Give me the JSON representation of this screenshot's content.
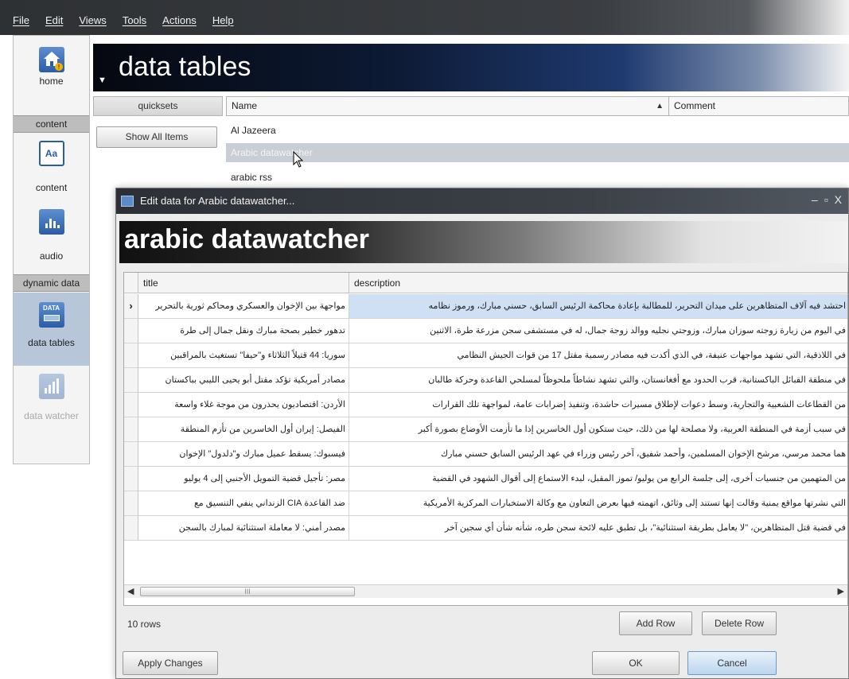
{
  "menu": [
    "File",
    "Edit",
    "Views",
    "Tools",
    "Actions",
    "Help"
  ],
  "sidebar": {
    "home": "home",
    "content_header": "content",
    "content": "content",
    "audio": "audio",
    "dynamic_header": "dynamic data",
    "data_tables": "data tables",
    "data_tables_icon_text": "DATA",
    "data_watcher": "data watcher"
  },
  "banner": {
    "title": "data tables"
  },
  "backpanel": {
    "quicksets": "quicksets",
    "show_all": "Show All Items",
    "name_header": "Name",
    "comment_header": "Comment",
    "sort_indicator": "▲",
    "rows": [
      "Al Jazeera",
      "Arabic datawatcher",
      "arabic rss"
    ]
  },
  "dialog": {
    "title": "Edit data for Arabic datawatcher...",
    "banner": "arabic datawatcher",
    "col_title": "title",
    "col_description": "description",
    "current_row_marker": "›",
    "rows": [
      {
        "title": "مواجهة بين الإخوان والعسكري ومحاكم ثورية بالتحرير",
        "description": "احتشد فيه آلاف المتظاهرين على ميدان التحرير، للمطالبة بإعادة محاكمة الرئيس السابق، حسني مبارك، ورموز نظامه"
      },
      {
        "title": "تدهور خطير بصحة مبارك ونقل جمال إلى طرة",
        "description": "في اليوم من زيارة زوجته سوزان مبارك، وزوجتي نجليه ووالد زوجة جمال، له في مستشفى سجن مزرعة طرة، الاثنين"
      },
      {
        "title": "سوريا: 44 قتيلاً الثلاثاء و\"حيفا\" تستغيث بالمراقبين",
        "description": "في اللاذقية، التي تشهد مواجهات عنيفة، في الذي أكدت فيه مصادر رسمية مقتل 17 من قوات الجيش النظامي"
      },
      {
        "title": "مصادر أمريكية تؤكد مقتل أبو يحيى الليبي بباكستان",
        "description": "في منطقة القبائل الباكستانية، قرب الحدود مع أفغانستان، والتي تشهد نشاطاً ملحوظاً لمسلحي القاعدة وحركة طالبان"
      },
      {
        "title": "الأردن: اقتصاديون يحذرون من موجة غلاء واسعة",
        "description": "من القطاعات الشعبية والتجارية، وسط دعوات لإطلاق مسيرات حاشدة، وتنفيذ إضرابات عامة، لمواجهة تلك القرارات"
      },
      {
        "title": "الفيصل: إيران أول الخاسرين من تأزم المنطقة",
        "description": "في سبب أزمة في المنطقة العربية، ولا مصلحة لها من ذلك، حيث ستكون أول الخاسرين إذا ما تأزمت الأوضاع بصورة أكبر"
      },
      {
        "title": "فيسبوك: يسقط عميل مبارك و\"دلدول\" الإخوان",
        "description": "هما محمد مرسي، مرشح الإخوان المسلمين، وأحمد شفيق، آخر رئيس وزراء في عهد الرئيس السابق حسني مبارك"
      },
      {
        "title": "مصر: تأجيل قضية التمويل الأجنبي إلى 4 يوليو",
        "description": "من المتهمين من جنسيات أخرى، إلى جلسة الرابع من يوليو/ تموز المقبل، لبدء الاستماع إلى أقوال الشهود في القضية"
      },
      {
        "title": "ضد القاعدة CIA الزنداني ينفي التنسيق مع",
        "description": "التي نشرتها مواقع يمنية وقالت إنها تستند إلى وثائق، اتهمته فيها بعرض التعاون مع وكالة الاستخبارات المركزية الأمريكية"
      },
      {
        "title": "مصدر أمني: لا معاملة استثنائية لمبارك بالسجن",
        "description": "في قضية قتل المتظاهرين، \"لا يعامل بطريقة استثنائية\"، بل تطبق عليه لائحة سجن طره، شأنه شأن أي سجين آخر"
      }
    ],
    "scroll_grip": "III",
    "row_count": "10 rows",
    "add_row": "Add Row",
    "delete_row": "Delete Row",
    "apply": "Apply Changes",
    "ok": "OK",
    "cancel": "Cancel"
  }
}
